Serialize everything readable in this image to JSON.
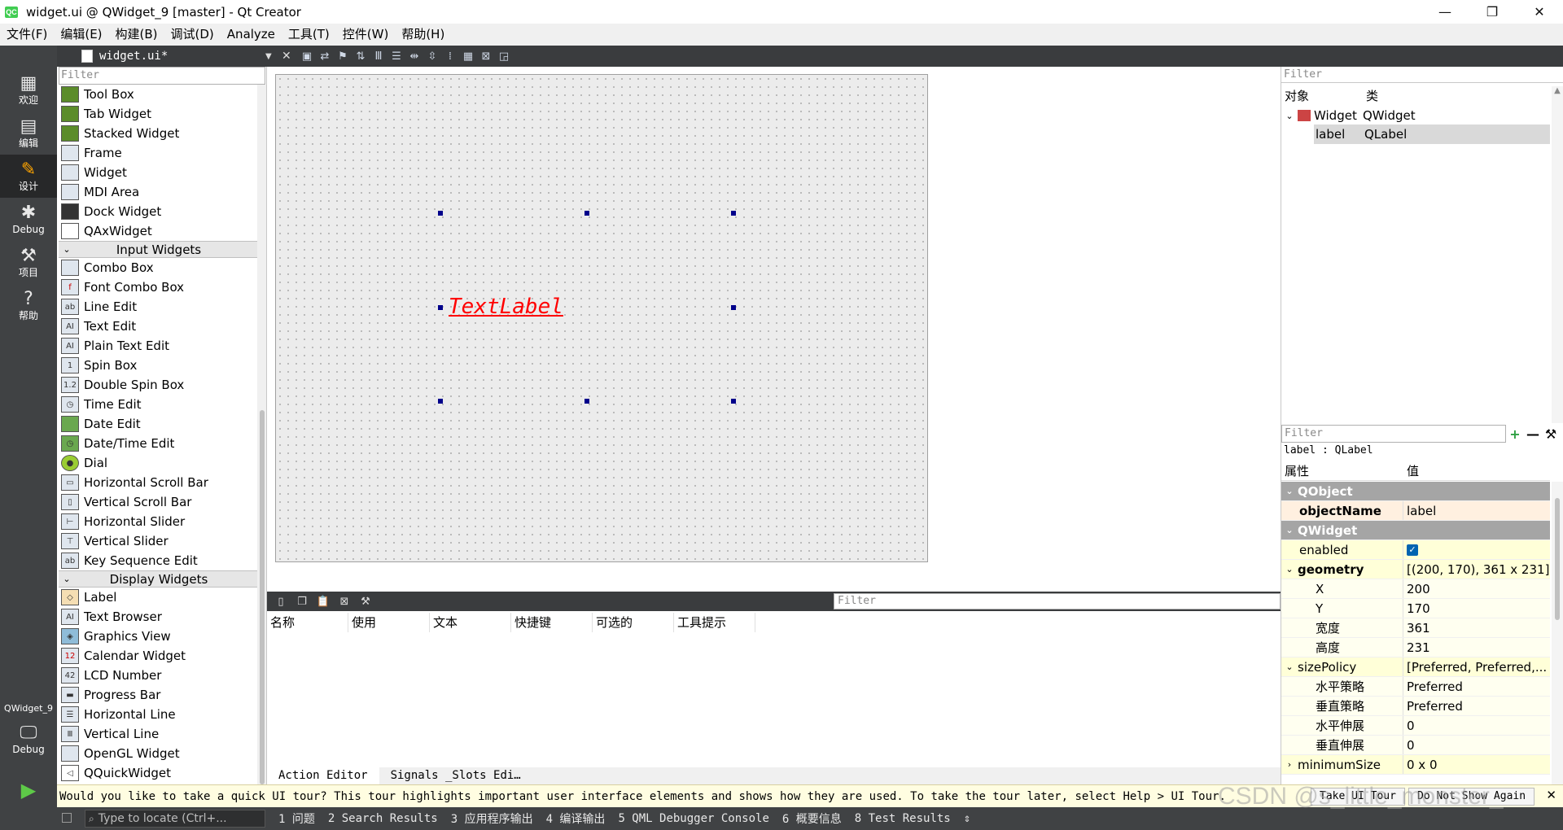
{
  "window": {
    "title": "widget.ui @ QWidget_9 [master] - Qt Creator",
    "logo": "QC",
    "controls": {
      "minimize": "—",
      "maximize": "❐",
      "close": "✕"
    }
  },
  "menu": [
    "文件(F)",
    "编辑(E)",
    "构建(B)",
    "调试(D)",
    "Analyze",
    "工具(T)",
    "控件(W)",
    "帮助(H)"
  ],
  "modes": [
    {
      "label": "欢迎",
      "icon": "grid-icon"
    },
    {
      "label": "编辑",
      "icon": "edit-doc-icon"
    },
    {
      "label": "设计",
      "icon": "pencil-icon"
    },
    {
      "label": "Debug",
      "icon": "bug-icon"
    },
    {
      "label": "项目",
      "icon": "wrench-icon"
    },
    {
      "label": "帮助",
      "icon": "help-icon"
    }
  ],
  "project": {
    "name": "QWidget_9",
    "kit_label": "Debug"
  },
  "editor": {
    "document": "widget.ui*"
  },
  "widgetbox": {
    "filter_placeholder": "Filter",
    "items_top": [
      "Tool Box",
      "Tab Widget",
      "Stacked Widget",
      "Frame",
      "Widget",
      "MDI Area",
      "Dock Widget",
      "QAxWidget"
    ],
    "input_category": "Input Widgets",
    "input_items": [
      "Combo Box",
      "Font Combo Box",
      "Line Edit",
      "Text Edit",
      "Plain Text Edit",
      "Spin Box",
      "Double Spin Box",
      "Time Edit",
      "Date Edit",
      "Date/Time Edit",
      "Dial",
      "Horizontal Scroll Bar",
      "Vertical Scroll Bar",
      "Horizontal Slider",
      "Vertical Slider",
      "Key Sequence Edit"
    ],
    "display_category": "Display Widgets",
    "display_items": [
      "Label",
      "Text Browser",
      "Graphics View",
      "Calendar Widget",
      "LCD Number",
      "Progress Bar",
      "Horizontal Line",
      "Vertical Line",
      "OpenGL Widget",
      "QQuickWidget"
    ]
  },
  "form": {
    "label_text": "TextLabel"
  },
  "action_editor": {
    "filter_placeholder": "Filter",
    "columns": [
      "名称",
      "使用",
      "文本",
      "快捷键",
      "可选的",
      "工具提示"
    ],
    "tabs": [
      "Action Editor",
      "Signals _Slots Edi…"
    ]
  },
  "object_inspector": {
    "filter_placeholder": "Filter",
    "columns": [
      "对象",
      "类"
    ],
    "rows": [
      {
        "object": "Widget",
        "class": "QWidget"
      },
      {
        "object": "label",
        "class": "QLabel"
      }
    ]
  },
  "property_editor": {
    "filter_placeholder": "Filter",
    "class_line": "label : QLabel",
    "columns": [
      "属性",
      "值"
    ],
    "groups": {
      "qobject": "QObject",
      "qwidget": "QWidget"
    },
    "rows": {
      "objectName": {
        "name": "objectName",
        "value": "label"
      },
      "enabled": {
        "name": "enabled",
        "value": "✓"
      },
      "geometry": {
        "name": "geometry",
        "value": "[(200, 170), 361 x 231]"
      },
      "x": {
        "name": "X",
        "value": "200"
      },
      "y": {
        "name": "Y",
        "value": "170"
      },
      "width": {
        "name": "宽度",
        "value": "361"
      },
      "height": {
        "name": "高度",
        "value": "231"
      },
      "sizePolicy": {
        "name": "sizePolicy",
        "value": "[Preferred, Preferred,..."
      },
      "hpolicy": {
        "name": "水平策略",
        "value": "Preferred"
      },
      "vpolicy": {
        "name": "垂直策略",
        "value": "Preferred"
      },
      "hstretch": {
        "name": "水平伸展",
        "value": "0"
      },
      "vstretch": {
        "name": "垂直伸展",
        "value": "0"
      },
      "minimumSize": {
        "name": "minimumSize",
        "value": "0 x 0"
      }
    }
  },
  "tour": {
    "message": "Would you like to take a quick UI tour? This tour highlights important user interface elements and shows how they are used. To take the tour later, select Help > UI Tour.",
    "take_button": "Take UI Tour",
    "dismiss_button": "Do Not Show Again"
  },
  "statusbar": {
    "locator_placeholder": "Type to locate (Ctrl+...",
    "panes": [
      "1 问题",
      "2 Search Results",
      "3 应用程序输出",
      "4 编译输出",
      "5 QML Debugger Console",
      "6 概要信息",
      "8 Test Results"
    ]
  },
  "watermark": "CSDN @s_little_monster_"
}
